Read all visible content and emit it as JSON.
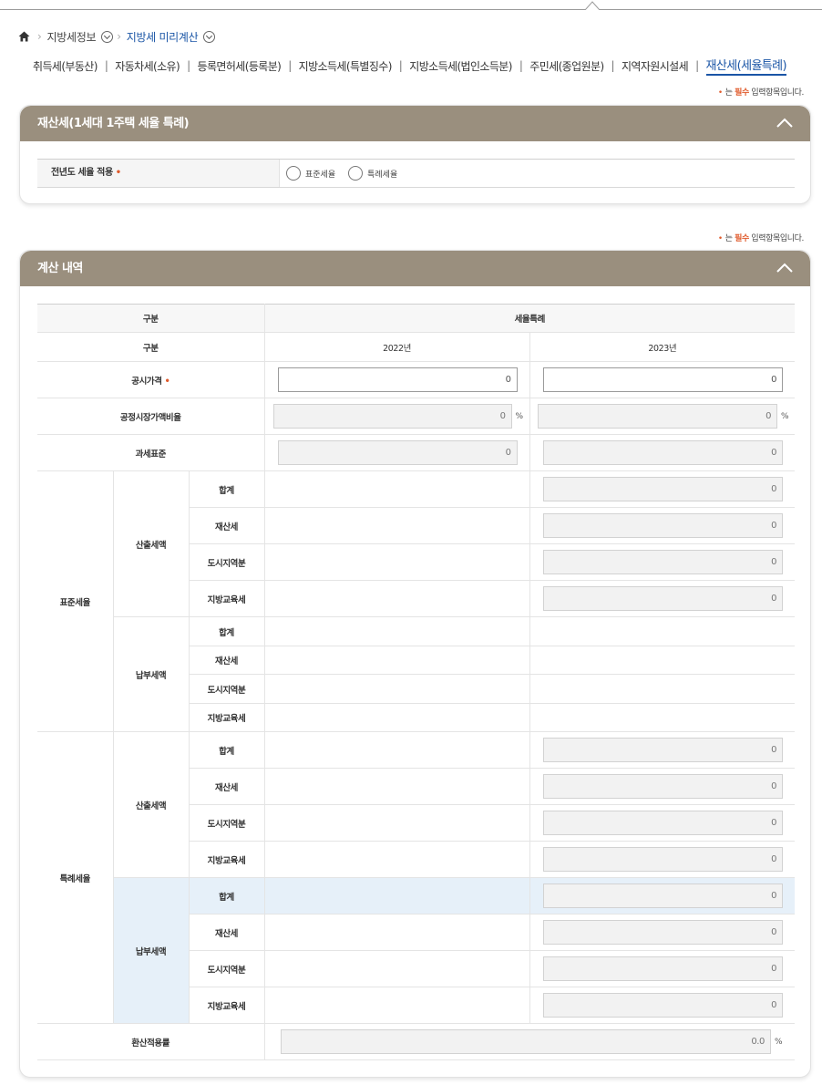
{
  "breadcrumb": {
    "level1": "지방세정보",
    "level2": "지방세 미리계산"
  },
  "tabs": [
    {
      "label": "취득세(부동산)"
    },
    {
      "label": "자동차세(소유)"
    },
    {
      "label": "등록면허세(등록분)"
    },
    {
      "label": "지방소득세(특별징수)"
    },
    {
      "label": "지방소득세(법인소득분)"
    },
    {
      "label": "주민세(종업원분)"
    },
    {
      "label": "지역자원시설세"
    },
    {
      "label": "재산세(세율특례)",
      "active": true
    }
  ],
  "required_note": {
    "marker": "•",
    "pre": "는 ",
    "emph": "필수",
    "post": " 입력항목입니다."
  },
  "panel1": {
    "title": "재산세(1세대 1주택 세율 특례)",
    "field_label": "전년도 세율 적용",
    "required_mark": "•",
    "options": [
      "표준세율",
      "특례세율"
    ]
  },
  "panel2": {
    "title": "계산 내역",
    "header": {
      "col1": "구분",
      "col2": "세율특례"
    },
    "sub_header": {
      "label": "구분",
      "year1": "2022년",
      "year2": "2023년"
    },
    "rows": {
      "public_price": {
        "label": "공시가격",
        "req": "•",
        "v1": "0",
        "v2": "0"
      },
      "fair_ratio": {
        "label": "공정시장가액비율",
        "v1": "0",
        "v2": "0",
        "unit": "%"
      },
      "tax_base": {
        "label": "과세표준",
        "v1": "0",
        "v2": "0"
      },
      "standard": "표준세율",
      "special": "특례세율",
      "computed": "산출세액",
      "payable": "납부세액",
      "items": [
        "합계",
        "재산세",
        "도시지역분",
        "지방교육세"
      ],
      "std_computed_values": [
        "0",
        "0",
        "0",
        "0"
      ],
      "sp_computed_values": [
        "0",
        "0",
        "0",
        "0"
      ],
      "sp_payable_values": [
        "0",
        "0",
        "0",
        "0"
      ],
      "conversion": {
        "label": "환산적용률",
        "value": "0.0",
        "unit": "%"
      }
    }
  },
  "colors": {
    "header_bg": "#9a8f7e",
    "accent": "#1a55a6",
    "required": "#e05a2b",
    "highlight": "#e6f0f9"
  }
}
